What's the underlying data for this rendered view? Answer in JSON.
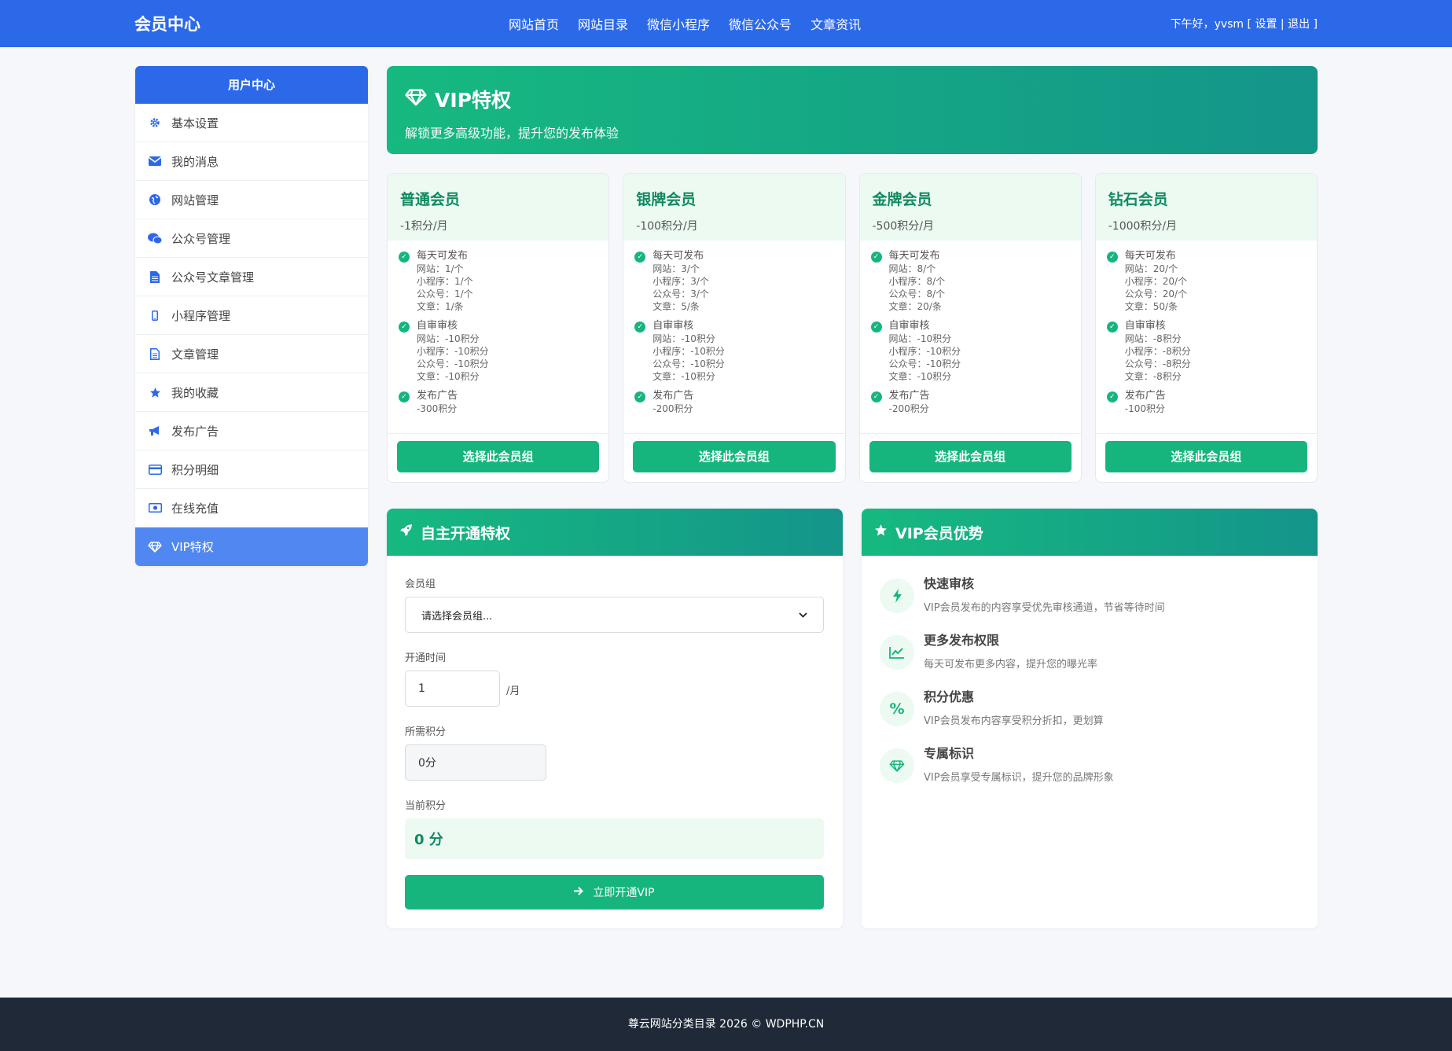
{
  "header": {
    "brand": "会员中心",
    "nav": [
      "网站首页",
      "网站目录",
      "微信小程序",
      "微信公众号",
      "文章资讯"
    ],
    "greeting": "下午好，",
    "user": "yvsm",
    "settings": "设置",
    "logout": "退出"
  },
  "sidebar": {
    "title": "用户中心",
    "items": [
      {
        "label": "基本设置",
        "icon": "gear-icon"
      },
      {
        "label": "我的消息",
        "icon": "envelope-icon"
      },
      {
        "label": "网站管理",
        "icon": "globe-icon"
      },
      {
        "label": "公众号管理",
        "icon": "wechat-icon"
      },
      {
        "label": "公众号文章管理",
        "icon": "file-icon"
      },
      {
        "label": "小程序管理",
        "icon": "mobile-icon"
      },
      {
        "label": "文章管理",
        "icon": "document-icon"
      },
      {
        "label": "我的收藏",
        "icon": "star-icon"
      },
      {
        "label": "发布广告",
        "icon": "bullhorn-icon"
      },
      {
        "label": "积分明细",
        "icon": "credit-card-icon"
      },
      {
        "label": "在线充值",
        "icon": "money-icon"
      },
      {
        "label": "VIP特权",
        "icon": "diamond-icon"
      }
    ],
    "active_index": 11
  },
  "hero": {
    "title": "VIP特权",
    "subtitle": "解锁更多高级功能，提升您的发布体验"
  },
  "plans": [
    {
      "name": "普通会员",
      "price": "-1积分/月",
      "daily_title": "每天可发布",
      "daily": [
        "网站：1/个",
        "小程序：1/个",
        "公众号：1/个",
        "文章：1/条"
      ],
      "review_title": "自审审核",
      "review": [
        "网站：-10积分",
        "小程序：-10积分",
        "公众号：-10积分",
        "文章：-10积分"
      ],
      "ad_title": "发布广告",
      "ad": "-300积分",
      "button": "选择此会员组"
    },
    {
      "name": "银牌会员",
      "price": "-100积分/月",
      "daily_title": "每天可发布",
      "daily": [
        "网站：3/个",
        "小程序：3/个",
        "公众号：3/个",
        "文章：5/条"
      ],
      "review_title": "自审审核",
      "review": [
        "网站：-10积分",
        "小程序：-10积分",
        "公众号：-10积分",
        "文章：-10积分"
      ],
      "ad_title": "发布广告",
      "ad": "-200积分",
      "button": "选择此会员组"
    },
    {
      "name": "金牌会员",
      "price": "-500积分/月",
      "daily_title": "每天可发布",
      "daily": [
        "网站：8/个",
        "小程序：8/个",
        "公众号：8/个",
        "文章：20/条"
      ],
      "review_title": "自审审核",
      "review": [
        "网站：-10积分",
        "小程序：-10积分",
        "公众号：-10积分",
        "文章：-10积分"
      ],
      "ad_title": "发布广告",
      "ad": "-200积分",
      "button": "选择此会员组"
    },
    {
      "name": "钻石会员",
      "price": "-1000积分/月",
      "daily_title": "每天可发布",
      "daily": [
        "网站：20/个",
        "小程序：20/个",
        "公众号：20/个",
        "文章：50/条"
      ],
      "review_title": "自审审核",
      "review": [
        "网站：-8积分",
        "小程序：-8积分",
        "公众号：-8积分",
        "文章：-8积分"
      ],
      "ad_title": "发布广告",
      "ad": "-100积分",
      "button": "选择此会员组"
    }
  ],
  "open_form": {
    "title": "自主开通特权",
    "group_label": "会员组",
    "group_placeholder": "请选择会员组...",
    "duration_label": "开通时间",
    "duration_value": "1",
    "duration_unit": "/月",
    "required_label": "所需积分",
    "required_value": "0分",
    "current_label": "当前积分",
    "current_value": "0 分",
    "submit": "立即开通VIP"
  },
  "advantages": {
    "title": "VIP会员优势",
    "items": [
      {
        "title": "快速审核",
        "desc": "VIP会员发布的内容享受优先审核通道，节省等待时间",
        "icon": "bolt-icon"
      },
      {
        "title": "更多发布权限",
        "desc": "每天可发布更多内容，提升您的曝光率",
        "icon": "chart-line-icon"
      },
      {
        "title": "积分优惠",
        "desc": "VIP会员发布内容享受积分折扣，更划算",
        "icon": "percent-icon"
      },
      {
        "title": "专属标识",
        "desc": "VIP会员享受专属标识，提升您的品牌形象",
        "icon": "diamond-icon"
      }
    ]
  },
  "footer": "尊云网站分类目录 2026 © WDPHP.CN",
  "colors": {
    "primary": "#2c69e8",
    "accent": "#17b57e",
    "accent_dark": "#14958a",
    "footer": "#1f2937"
  }
}
